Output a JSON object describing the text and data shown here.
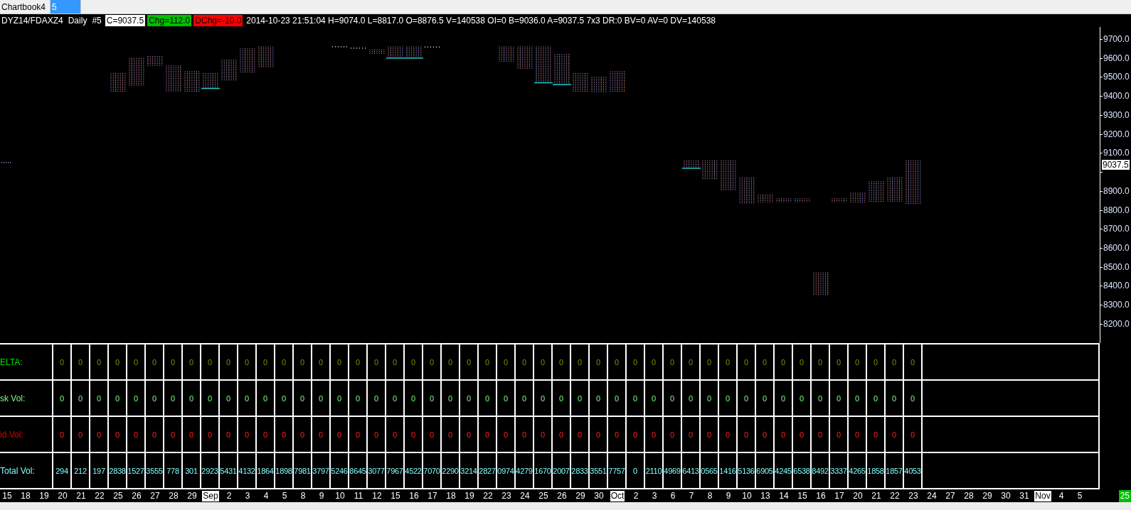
{
  "tabs": [
    {
      "label": "Chartbook4",
      "selected": false
    },
    {
      "label": "5",
      "selected": true
    }
  ],
  "header": [
    {
      "kind": "plain",
      "text": "DYZ14/FDAXZ4"
    },
    {
      "kind": "plain",
      "text": "Daily"
    },
    {
      "kind": "plain",
      "text": "#5"
    },
    {
      "kind": "close",
      "text": "C=9037.5"
    },
    {
      "kind": "chg",
      "text": "Chg=112.0"
    },
    {
      "kind": "dchg",
      "text": "DChg=-10.0"
    },
    {
      "kind": "plain",
      "text": "2014-10-23 21:51:04 H=9074.0 L=8817.0 O=8876.5 V=140538 OI=0 B=9036.0 A=9037.5 7x3 DR:0 BV=0 AV=0 DV=140538"
    }
  ],
  "chart": {
    "price_labels": [
      "9700.0",
      "9600.0",
      "9500.0",
      "9400.0",
      "9300.0",
      "9200.0",
      "9100.0",
      "8900.0",
      "8800.0",
      "8700.0",
      "8600.0",
      "8500.0",
      "8400.0",
      "8300.0",
      "8200.0"
    ],
    "last_price": "9037.5"
  },
  "table": {
    "rows": [
      {
        "kind": "delta",
        "label": "ELTA:",
        "values": [
          "0",
          "0",
          "0",
          "0",
          "0",
          "0",
          "0",
          "0",
          "0",
          "0",
          "0",
          "0",
          "0",
          "0",
          "0",
          "0",
          "0",
          "0",
          "0",
          "0",
          "0",
          "0",
          "0",
          "0",
          "0",
          "0",
          "0",
          "0",
          "0",
          "0",
          "0",
          "0",
          "0",
          "0",
          "0",
          "0",
          "0",
          "0",
          "0",
          "0",
          "0",
          "0",
          "0",
          "0",
          "0",
          "0",
          "0"
        ]
      },
      {
        "kind": "ask",
        "label": "sk Vol:",
        "values": [
          "0",
          "0",
          "0",
          "0",
          "0",
          "0",
          "0",
          "0",
          "0",
          "0",
          "0",
          "0",
          "0",
          "0",
          "0",
          "0",
          "0",
          "0",
          "0",
          "0",
          "0",
          "0",
          "0",
          "0",
          "0",
          "0",
          "0",
          "0",
          "0",
          "0",
          "0",
          "0",
          "0",
          "0",
          "0",
          "0",
          "0",
          "0",
          "0",
          "0",
          "0",
          "0",
          "0",
          "0",
          "0",
          "0",
          "0"
        ]
      },
      {
        "kind": "bid",
        "label": "id Vol:",
        "values": [
          "0",
          "0",
          "0",
          "0",
          "0",
          "0",
          "0",
          "0",
          "0",
          "0",
          "0",
          "0",
          "0",
          "0",
          "0",
          "0",
          "0",
          "0",
          "0",
          "0",
          "0",
          "0",
          "0",
          "0",
          "0",
          "0",
          "0",
          "0",
          "0",
          "0",
          "0",
          "0",
          "0",
          "0",
          "0",
          "0",
          "0",
          "0",
          "0",
          "0",
          "0",
          "0",
          "0",
          "0",
          "0",
          "0",
          "0"
        ]
      },
      {
        "kind": "total",
        "label": "Total Vol:",
        "values": [
          "294",
          "212",
          "197",
          "2838",
          "1527",
          "3555",
          "778",
          "301",
          "2923",
          "5431",
          "4132",
          "1864",
          "1898",
          "7981",
          "3797",
          "5246",
          "8645",
          "3077",
          "7967",
          "4522",
          "7070",
          "2290",
          "3214",
          "2827",
          "0974",
          "4279",
          "1670",
          "2007",
          "2833",
          "3551",
          "7757",
          "0",
          "2110",
          "4969",
          "6413",
          "0565",
          "1416",
          "5136",
          "6905",
          "4245",
          "6538",
          "8492",
          "3337",
          "4265",
          "1858",
          "1857",
          "4053"
        ]
      }
    ]
  },
  "date_axis": {
    "labels": [
      {
        "kind": "day",
        "text": "15"
      },
      {
        "kind": "day",
        "text": "18"
      },
      {
        "kind": "day",
        "text": "19"
      },
      {
        "kind": "day",
        "text": "20"
      },
      {
        "kind": "day",
        "text": "21"
      },
      {
        "kind": "day",
        "text": "22"
      },
      {
        "kind": "day",
        "text": "25"
      },
      {
        "kind": "day",
        "text": "26"
      },
      {
        "kind": "day",
        "text": "27"
      },
      {
        "kind": "day",
        "text": "28"
      },
      {
        "kind": "day",
        "text": "29"
      },
      {
        "kind": "month",
        "text": "Sep"
      },
      {
        "kind": "day",
        "text": "2"
      },
      {
        "kind": "day",
        "text": "3"
      },
      {
        "kind": "day",
        "text": "4"
      },
      {
        "kind": "day",
        "text": "5"
      },
      {
        "kind": "day",
        "text": "8"
      },
      {
        "kind": "day",
        "text": "9"
      },
      {
        "kind": "day",
        "text": "10"
      },
      {
        "kind": "day",
        "text": "11"
      },
      {
        "kind": "day",
        "text": "12"
      },
      {
        "kind": "day",
        "text": "15"
      },
      {
        "kind": "day",
        "text": "16"
      },
      {
        "kind": "day",
        "text": "17"
      },
      {
        "kind": "day",
        "text": "18"
      },
      {
        "kind": "day",
        "text": "19"
      },
      {
        "kind": "day",
        "text": "22"
      },
      {
        "kind": "day",
        "text": "23"
      },
      {
        "kind": "day",
        "text": "24"
      },
      {
        "kind": "day",
        "text": "25"
      },
      {
        "kind": "day",
        "text": "26"
      },
      {
        "kind": "day",
        "text": "29"
      },
      {
        "kind": "day",
        "text": "30"
      },
      {
        "kind": "month",
        "text": "Oct"
      },
      {
        "kind": "day",
        "text": "2"
      },
      {
        "kind": "day",
        "text": "3"
      },
      {
        "kind": "day",
        "text": "6"
      },
      {
        "kind": "day",
        "text": "7"
      },
      {
        "kind": "day",
        "text": "8"
      },
      {
        "kind": "day",
        "text": "9"
      },
      {
        "kind": "day",
        "text": "10"
      },
      {
        "kind": "day",
        "text": "13"
      },
      {
        "kind": "day",
        "text": "14"
      },
      {
        "kind": "day",
        "text": "15"
      },
      {
        "kind": "day",
        "text": "16"
      },
      {
        "kind": "day",
        "text": "17"
      },
      {
        "kind": "day",
        "text": "20"
      },
      {
        "kind": "day",
        "text": "21"
      },
      {
        "kind": "day",
        "text": "22"
      },
      {
        "kind": "day",
        "text": "23"
      },
      {
        "kind": "day",
        "text": "24"
      },
      {
        "kind": "day",
        "text": "27"
      },
      {
        "kind": "day",
        "text": "28"
      },
      {
        "kind": "day",
        "text": "29"
      },
      {
        "kind": "day",
        "text": "30"
      },
      {
        "kind": "day",
        "text": "31"
      },
      {
        "kind": "month",
        "text": "Nov"
      },
      {
        "kind": "day",
        "text": "4"
      },
      {
        "kind": "day",
        "text": "5"
      }
    ],
    "current": "25"
  }
}
